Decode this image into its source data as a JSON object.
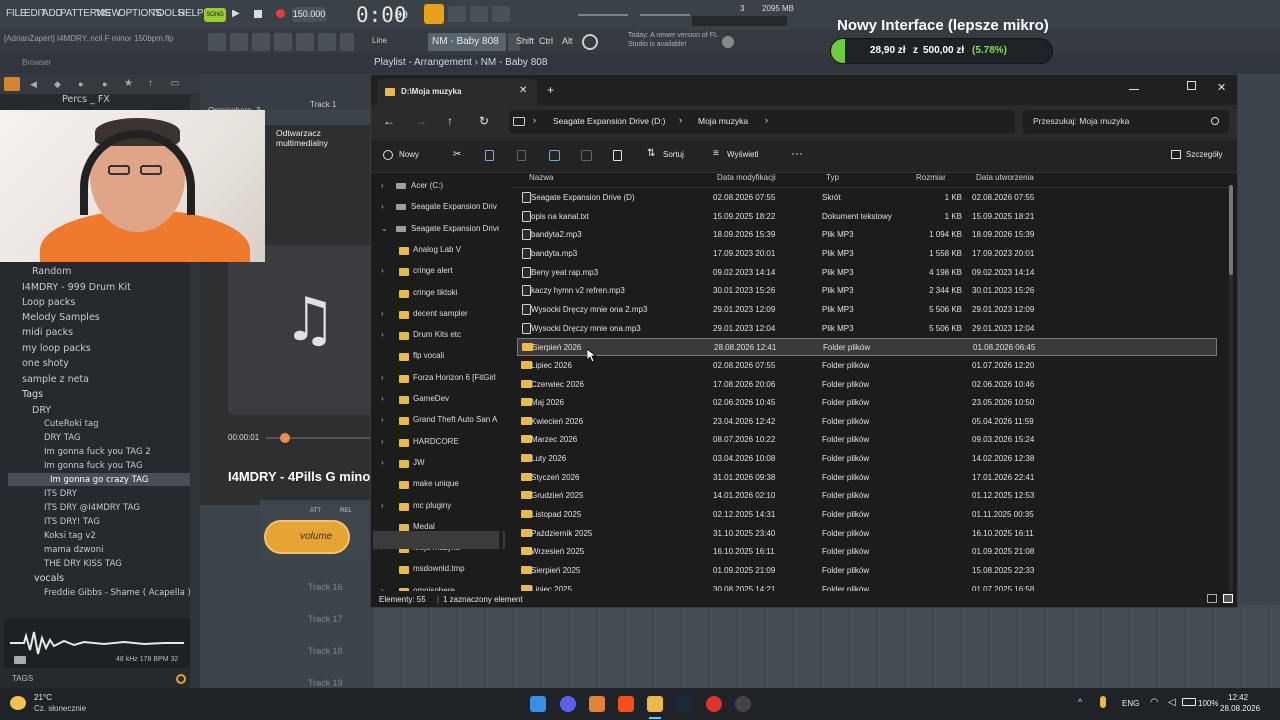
{
  "fl": {
    "menu": [
      "FILE",
      "EDIT",
      "ADD",
      "PATTERNS",
      "VIEW",
      "OPTIONS",
      "TOOLS",
      "HELP"
    ],
    "song_badge": "SONG",
    "tempo": "150.000",
    "time": "0:00",
    "time_small": "00",
    "mem": "2095 MB",
    "voices": "3",
    "project_hint": "[AdrianZapert] I4MDRY..ncil F minor 150bpm.flp",
    "line_label": "Line",
    "pattern": "NM - Baby 808",
    "shift": "Shift",
    "ctrl": "Ctrl",
    "alt": "Alt",
    "update_msg": "Today: A newer version of FL Studio is available!",
    "browser_label": "Browser",
    "playlist_title": "Playlist - Arrangement › NM - Baby 808",
    "track1": "Track 1",
    "omni": "Omnisphere_3",
    "percs": "Percs _ FX",
    "tracks": [
      "Track 16",
      "Track 17",
      "Track 18",
      "Track 19"
    ],
    "browser_items": [
      "Random",
      "I4MDRY - 999 Drum Kit",
      "Loop packs",
      "Melody Samples",
      "midi packs",
      "my loop packs",
      "one shoty",
      "sample z neta",
      "Tags",
      "DRY",
      "CuteRoki tag",
      "DRY TAG",
      "Im gonna fuck you TAG 2",
      "Im gonna fuck you TAG",
      "Im gonna go crazy TAG",
      "ITS DRY",
      "ITS DRY @I4MDRY TAG",
      "ITS DRY! TAG",
      "Koksi tag v2",
      "mama dzwoni",
      "THE DRY KISS TAG",
      "vocals",
      "Freddie Gibbs - Shame ( Acapella )"
    ],
    "sample_info": "48 kHz 178 BPM 32",
    "tags_label": "TAGS"
  },
  "mediaplayer": {
    "title": "Odtwarzacz multimedialny",
    "time": "00:00:01",
    "track": "I4MDRY - 4Pills G minor"
  },
  "plugin": {
    "volume": "volume",
    "att": "ATT",
    "rel": "REL"
  },
  "overlay": {
    "title": "Nowy Interface (lepsze mikro)",
    "amount": "28,90 zł",
    "of": "z",
    "goal": "500,00 zł",
    "percent": "(5.78%)",
    "progress": 0.0578
  },
  "explorer": {
    "tab_title": "D:\\Moja muzyka",
    "breadcrumb": [
      "Seagate Expansion Drive (D:)",
      "Moja muzyka"
    ],
    "search_placeholder": "Przeszukaj: Moja muzyka",
    "cmd": {
      "new": "Nowy",
      "sort": "Sortuj",
      "view": "Wyświetl",
      "details": "Szczegóły"
    },
    "columns": [
      "Nazwa",
      "Data modyfikacji",
      "Typ",
      "Rozmiar",
      "Data utworzenia"
    ],
    "nav": [
      {
        "label": "Acer (C:)",
        "chev": "›",
        "kind": "drive"
      },
      {
        "label": "Seagate Expansion Driv",
        "chev": "›",
        "kind": "drive"
      },
      {
        "label": "Seagate Expansion Drive",
        "chev": "⌄",
        "kind": "drive"
      },
      {
        "label": "Analog Lab V",
        "chev": "",
        "kind": "folder"
      },
      {
        "label": "cringe alert",
        "chev": "›",
        "kind": "folder"
      },
      {
        "label": "cringe tiktoki",
        "chev": "",
        "kind": "folder"
      },
      {
        "label": "decent sampler",
        "chev": "›",
        "kind": "folder"
      },
      {
        "label": "Drum Kits etc",
        "chev": "›",
        "kind": "folder"
      },
      {
        "label": "flp vocali",
        "chev": "",
        "kind": "folder"
      },
      {
        "label": "Forza Horizon 6 [FitGirl",
        "chev": "›",
        "kind": "folder"
      },
      {
        "label": "GameDev",
        "chev": "›",
        "kind": "folder"
      },
      {
        "label": "Grand Theft Auto San A",
        "chev": "›",
        "kind": "folder"
      },
      {
        "label": "HARDCORE",
        "chev": "›",
        "kind": "folder"
      },
      {
        "label": "JW",
        "chev": "›",
        "kind": "folder"
      },
      {
        "label": "make unique",
        "chev": "",
        "kind": "folder"
      },
      {
        "label": "mc pluginy",
        "chev": "›",
        "kind": "folder"
      },
      {
        "label": "Medal",
        "chev": "",
        "kind": "folder"
      },
      {
        "label": "Moja muzyka",
        "chev": "›",
        "kind": "folder"
      },
      {
        "label": "msdownld.tmp",
        "chev": "",
        "kind": "folder"
      },
      {
        "label": "omnisphere",
        "chev": "›",
        "kind": "folder"
      }
    ],
    "files": [
      {
        "name": "Seagate Expansion Drive (D)",
        "mod": "02.08.2026 07:55",
        "type": "Skrót",
        "size": "1 KB",
        "created": "02.08.2026 07:55",
        "kind": "shortcut"
      },
      {
        "name": "opis na kanal.txt",
        "mod": "15.09.2025 18:22",
        "type": "Dokument tekstowy",
        "size": "1 KB",
        "created": "15.09.2025 18:21",
        "kind": "file"
      },
      {
        "name": "bandyta2.mp3",
        "mod": "18.09.2026 15:39",
        "type": "Plik MP3",
        "size": "1 094 KB",
        "created": "18.09.2026 15:39",
        "kind": "file"
      },
      {
        "name": "bandyta.mp3",
        "mod": "17.09.2023 20:01",
        "type": "Plik MP3",
        "size": "1 558 KB",
        "created": "17.09.2023 20:01",
        "kind": "file"
      },
      {
        "name": "Beny yeat rap.mp3",
        "mod": "09.02.2023 14:14",
        "type": "Plik MP3",
        "size": "4 198 KB",
        "created": "09.02.2023 14:14",
        "kind": "file"
      },
      {
        "name": "kaczy hymn v2 refren.mp3",
        "mod": "30.01.2023 15:26",
        "type": "Plik MP3",
        "size": "2 344 KB",
        "created": "30.01.2023 15:26",
        "kind": "file"
      },
      {
        "name": "Wysocki Dręczy mnie ona 2.mp3",
        "mod": "29.01.2023 12:09",
        "type": "Plik MP3",
        "size": "5 506 KB",
        "created": "29.01.2023 12:09",
        "kind": "file"
      },
      {
        "name": "Wysocki Dręczy mnie ona.mp3",
        "mod": "29.01.2023 12:04",
        "type": "Plik MP3",
        "size": "5 506 KB",
        "created": "29.01.2023 12:04",
        "kind": "file"
      },
      {
        "name": "Sierpień 2026",
        "mod": "28.08.2026 12:41",
        "type": "Folder plików",
        "size": "",
        "created": "01.08.2026 06:45",
        "kind": "folder",
        "selected": true
      },
      {
        "name": "Lipiec 2026",
        "mod": "02.08.2026 07:55",
        "type": "Folder plików",
        "size": "",
        "created": "01.07.2026 12:20",
        "kind": "folder"
      },
      {
        "name": "Czerwiec 2026",
        "mod": "17.08.2026 20:06",
        "type": "Folder plików",
        "size": "",
        "created": "02.06.2026 10:46",
        "kind": "folder"
      },
      {
        "name": "Maj 2026",
        "mod": "02.06.2026 10:45",
        "type": "Folder plików",
        "size": "",
        "created": "23.05.2026 10:50",
        "kind": "folder"
      },
      {
        "name": "Kwiecień 2026",
        "mod": "23.04.2026 12:42",
        "type": "Folder plików",
        "size": "",
        "created": "05.04.2026 11:59",
        "kind": "folder"
      },
      {
        "name": "Marzec 2026",
        "mod": "08.07.2026 10:22",
        "type": "Folder plików",
        "size": "",
        "created": "09.03.2026 15:24",
        "kind": "folder"
      },
      {
        "name": "Luty 2026",
        "mod": "03.04.2026 10:08",
        "type": "Folder plików",
        "size": "",
        "created": "14.02.2026 12:38",
        "kind": "folder"
      },
      {
        "name": "Styczeń 2026",
        "mod": "31.01.2026 09:38",
        "type": "Folder plików",
        "size": "",
        "created": "17.01.2026 22:41",
        "kind": "folder"
      },
      {
        "name": "Grudzień 2025",
        "mod": "14.01.2026 02:10",
        "type": "Folder plików",
        "size": "",
        "created": "01.12.2025 12:53",
        "kind": "folder"
      },
      {
        "name": "Listopad 2025",
        "mod": "02.12.2025 14:31",
        "type": "Folder plików",
        "size": "",
        "created": "01.11.2025 00:35",
        "kind": "folder"
      },
      {
        "name": "Październik 2025",
        "mod": "31.10.2025 23:40",
        "type": "Folder plików",
        "size": "",
        "created": "16.10.2025 16:11",
        "kind": "folder"
      },
      {
        "name": "Wrzesień 2025",
        "mod": "16.10.2025 16:11",
        "type": "Folder plików",
        "size": "",
        "created": "01.09.2025 21:08",
        "kind": "folder"
      },
      {
        "name": "Sierpień 2025",
        "mod": "01.09.2025 21:09",
        "type": "Folder plików",
        "size": "",
        "created": "15.08.2025 22:33",
        "kind": "folder"
      },
      {
        "name": "Lipiec 2025",
        "mod": "30.08.2025 14:21",
        "type": "Folder plików",
        "size": "",
        "created": "01.07.2025 16:58",
        "kind": "folder"
      }
    ],
    "status": "Elementy: 55",
    "status_sel": "1 zaznaczony element"
  },
  "taskbar": {
    "weather_temp": "21°C",
    "weather_desc": "Cz. słonecznie",
    "lang": "ENG",
    "battery": "100%",
    "time": "12:42",
    "date": "28.08.2026"
  }
}
